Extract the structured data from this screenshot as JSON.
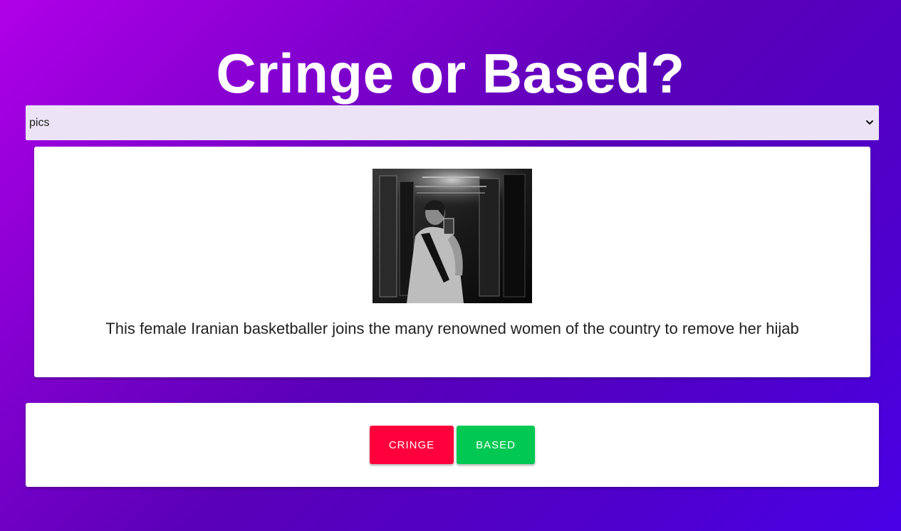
{
  "header": {
    "title": "Cringe or Based?"
  },
  "category_select": {
    "selected": "pics"
  },
  "post": {
    "caption": "This female Iranian basketballer joins the many renowned women of the country to remove her hijab",
    "image_icon": "photo-bw-selfie-elevator"
  },
  "actions": {
    "cringe_label": "CRINGE",
    "based_label": "BASED"
  },
  "colors": {
    "cringe": "#ff003c",
    "based": "#00c853",
    "gradient_start": "#b000e8",
    "gradient_end": "#4a00e6"
  }
}
